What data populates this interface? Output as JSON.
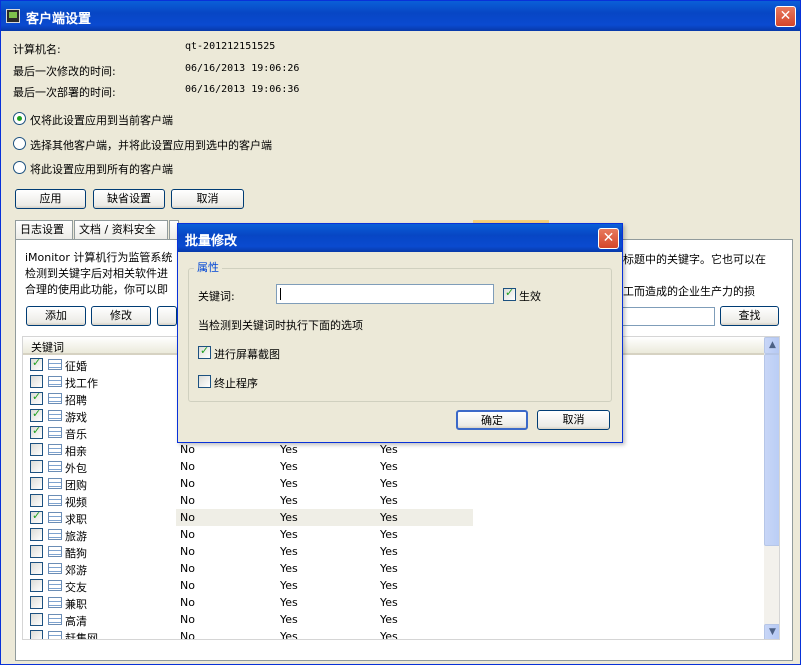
{
  "window": {
    "title": "客户端设置"
  },
  "info": [
    {
      "label": "计算机名:",
      "value": "qt-201212151525"
    },
    {
      "label": "最后一次修改的时间:",
      "value": "06/16/2013 19:06:26"
    },
    {
      "label": "最后一次部署的时间:",
      "value": "06/16/2013 19:06:36"
    }
  ],
  "radios": [
    {
      "label": "仅将此设置应用到当前客户端",
      "selected": true
    },
    {
      "label": "选择其他客户端，并将此设置应用到选中的客户端",
      "selected": false
    },
    {
      "label": "将此设置应用到所有的客户端",
      "selected": false
    }
  ],
  "actions": {
    "apply": "应用",
    "default": "缺省设置",
    "cancel": "取消"
  },
  "tabs": [
    "日志设置",
    "文档 / 资料安全"
  ],
  "description": {
    "line1": "iMonitor 计算机行为监管系统",
    "line2": "检测到关键字后对相关软件进",
    "line3": "合理的使用此功能，你可以即",
    "right1": "标题中的关键字。它也可以在",
    "right3": "工而造成的企业生产力的损"
  },
  "toolbar": {
    "add": "添加",
    "edit": "修改",
    "search": "查找"
  },
  "grid": {
    "header_keyword": "关键词",
    "rows": [
      {
        "keyword": "征婚",
        "checked": true,
        "c1": "",
        "c2": "",
        "c3": ""
      },
      {
        "keyword": "找工作",
        "checked": false,
        "c1": "",
        "c2": "",
        "c3": ""
      },
      {
        "keyword": "招聘",
        "checked": true,
        "c1": "",
        "c2": "",
        "c3": ""
      },
      {
        "keyword": "游戏",
        "checked": true,
        "c1": "",
        "c2": "",
        "c3": ""
      },
      {
        "keyword": "音乐",
        "checked": true,
        "c1": "",
        "c2": "",
        "c3": ""
      },
      {
        "keyword": "相亲",
        "checked": false,
        "c1": "No",
        "c2": "Yes",
        "c3": "Yes"
      },
      {
        "keyword": "外包",
        "checked": false,
        "c1": "No",
        "c2": "Yes",
        "c3": "Yes"
      },
      {
        "keyword": "团购",
        "checked": false,
        "c1": "No",
        "c2": "Yes",
        "c3": "Yes"
      },
      {
        "keyword": "视频",
        "checked": false,
        "c1": "No",
        "c2": "Yes",
        "c3": "Yes"
      },
      {
        "keyword": "求职",
        "checked": true,
        "c1": "No",
        "c2": "Yes",
        "c3": "Yes"
      },
      {
        "keyword": "旅游",
        "checked": false,
        "c1": "No",
        "c2": "Yes",
        "c3": "Yes"
      },
      {
        "keyword": "酷狗",
        "checked": false,
        "c1": "No",
        "c2": "Yes",
        "c3": "Yes"
      },
      {
        "keyword": "郊游",
        "checked": false,
        "c1": "No",
        "c2": "Yes",
        "c3": "Yes"
      },
      {
        "keyword": "交友",
        "checked": false,
        "c1": "No",
        "c2": "Yes",
        "c3": "Yes"
      },
      {
        "keyword": "兼职",
        "checked": false,
        "c1": "No",
        "c2": "Yes",
        "c3": "Yes"
      },
      {
        "keyword": "高清",
        "checked": false,
        "c1": "No",
        "c2": "Yes",
        "c3": "Yes"
      },
      {
        "keyword": "赶集网",
        "checked": false,
        "c1": "No",
        "c2": "Yes",
        "c3": "Yes"
      }
    ]
  },
  "dialog": {
    "title": "批量修改",
    "group": "属性",
    "keyword_label": "关键词:",
    "keyword_value": "",
    "enable_label": "生效",
    "enable_checked": true,
    "when_label": "当检测到关键词时执行下面的选项",
    "screenshot_label": "进行屏幕截图",
    "screenshot_checked": true,
    "terminate_label": "终止程序",
    "terminate_checked": false,
    "ok": "确定",
    "cancel": "取消"
  }
}
